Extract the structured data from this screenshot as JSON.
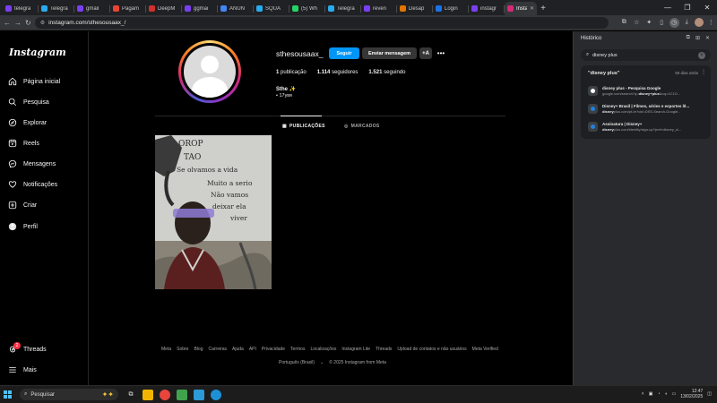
{
  "tabs": [
    {
      "label": "telegra",
      "color": "#7b3ff2"
    },
    {
      "label": "Telegra",
      "color": "#2aabee"
    },
    {
      "label": "gmail",
      "color": "#7b3ff2"
    },
    {
      "label": "Pagam",
      "color": "#ea4335"
    },
    {
      "label": "DeepM",
      "color": "#d0312d"
    },
    {
      "label": "ggmai",
      "color": "#7b3ff2"
    },
    {
      "label": "ANUN",
      "color": "#4285f4"
    },
    {
      "label": "SQUA",
      "color": "#2aabee"
    },
    {
      "label": "(5) Wh",
      "color": "#25d366"
    },
    {
      "label": "Telegra",
      "color": "#2aabee"
    },
    {
      "label": "reven",
      "color": "#7b3ff2"
    },
    {
      "label": "Desap",
      "color": "#e37400"
    },
    {
      "label": "Login",
      "color": "#1a73e8"
    },
    {
      "label": "instagr",
      "color": "#7b3ff2"
    },
    {
      "label": "Instag",
      "color": "#d62976",
      "active": true
    }
  ],
  "toolbar": {
    "url": "instagram.com/sthesousaax_/"
  },
  "instagram": {
    "logo": "Instagram",
    "nav": [
      {
        "key": "home",
        "label": "Página inicial",
        "icon": "home-icon"
      },
      {
        "key": "search",
        "label": "Pesquisa",
        "icon": "search-icon"
      },
      {
        "key": "explore",
        "label": "Explorar",
        "icon": "compass-icon"
      },
      {
        "key": "reels",
        "label": "Reels",
        "icon": "reels-icon"
      },
      {
        "key": "messages",
        "label": "Mensagens",
        "icon": "messenger-icon"
      },
      {
        "key": "notifications",
        "label": "Notificações",
        "icon": "heart-icon"
      },
      {
        "key": "create",
        "label": "Criar",
        "icon": "plus-square-icon"
      },
      {
        "key": "profile",
        "label": "Perfil",
        "icon": "profile-avatar-icon"
      }
    ],
    "threads": {
      "label": "Threads",
      "badge": "2"
    },
    "more": {
      "label": "Mais"
    },
    "profile": {
      "username": "sthesousaax_",
      "follow": "Seguir",
      "message": "Enviar mensagem",
      "add_user": "+A",
      "posts_count": "1",
      "posts_label": "publicação",
      "followers_count": "1.114",
      "followers_label": "seguidores",
      "following_count": "1.521",
      "following_label": "seguindo",
      "bio_name": "Sthe ✨",
      "bio_line": "• 17yᴇʀ"
    },
    "tabs": {
      "posts": "PUBLICAÇÕES",
      "tagged": "MARCADOS"
    },
    "post": {
      "lines": [
        "OROP",
        "TAO",
        "Se olvamos a vida",
        "Muito a serio",
        "Não vamos",
        "deixar ela",
        "viver"
      ]
    },
    "footer": {
      "links": [
        "Meta",
        "Sobre",
        "Blog",
        "Carreiras",
        "Ajuda",
        "API",
        "Privacidade",
        "Termos",
        "Localizações",
        "Instagram Lite",
        "Threads",
        "Upload de contatos e não usuários",
        "Meta Verified"
      ],
      "language": "Português (Brasil)",
      "copyright": "© 2025 Instagram from Meta"
    }
  },
  "history": {
    "title": "Histórico",
    "search_value": "disney plus",
    "group_title": "\"disney plus\"",
    "group_time": "59 dias atrás",
    "items": [
      {
        "title": "disney plus - Pesquisa Google",
        "url_pre": "google.com/search?q=",
        "url_bold": "disney+plus",
        "url_post": "&oq=1C1O...",
        "fav_color": "#ffffff"
      },
      {
        "title": "Disney+ Brasil | Filmes, séries e esportes lê...",
        "url_pre": "",
        "url_bold": "disney",
        "url_post": "plus.com/pt-br?cid=DSS-Search-Google...",
        "fav_color": "#1f80e0"
      },
      {
        "title": "Assinatura | Disney+",
        "url_pre": "",
        "url_bold": "disney",
        "url_post": "plus.com/identity/sign-up?pref=disney_si...",
        "fav_color": "#1f80e0"
      }
    ]
  },
  "taskbar": {
    "search_placeholder": "Pesquisar",
    "time": "12:47",
    "date": "13/02/2025"
  }
}
